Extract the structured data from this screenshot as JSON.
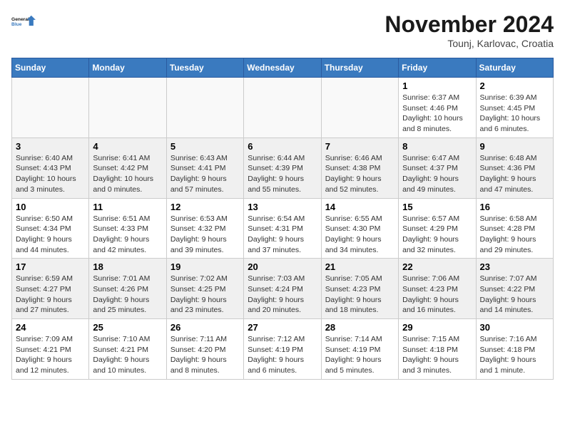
{
  "logo": {
    "text_general": "General",
    "text_blue": "Blue"
  },
  "title": "November 2024",
  "subtitle": "Tounj, Karlovac, Croatia",
  "days_of_week": [
    "Sunday",
    "Monday",
    "Tuesday",
    "Wednesday",
    "Thursday",
    "Friday",
    "Saturday"
  ],
  "weeks": [
    [
      {
        "day": "",
        "info": ""
      },
      {
        "day": "",
        "info": ""
      },
      {
        "day": "",
        "info": ""
      },
      {
        "day": "",
        "info": ""
      },
      {
        "day": "",
        "info": ""
      },
      {
        "day": "1",
        "info": "Sunrise: 6:37 AM\nSunset: 4:46 PM\nDaylight: 10 hours and 8 minutes."
      },
      {
        "day": "2",
        "info": "Sunrise: 6:39 AM\nSunset: 4:45 PM\nDaylight: 10 hours and 6 minutes."
      }
    ],
    [
      {
        "day": "3",
        "info": "Sunrise: 6:40 AM\nSunset: 4:43 PM\nDaylight: 10 hours and 3 minutes."
      },
      {
        "day": "4",
        "info": "Sunrise: 6:41 AM\nSunset: 4:42 PM\nDaylight: 10 hours and 0 minutes."
      },
      {
        "day": "5",
        "info": "Sunrise: 6:43 AM\nSunset: 4:41 PM\nDaylight: 9 hours and 57 minutes."
      },
      {
        "day": "6",
        "info": "Sunrise: 6:44 AM\nSunset: 4:39 PM\nDaylight: 9 hours and 55 minutes."
      },
      {
        "day": "7",
        "info": "Sunrise: 6:46 AM\nSunset: 4:38 PM\nDaylight: 9 hours and 52 minutes."
      },
      {
        "day": "8",
        "info": "Sunrise: 6:47 AM\nSunset: 4:37 PM\nDaylight: 9 hours and 49 minutes."
      },
      {
        "day": "9",
        "info": "Sunrise: 6:48 AM\nSunset: 4:36 PM\nDaylight: 9 hours and 47 minutes."
      }
    ],
    [
      {
        "day": "10",
        "info": "Sunrise: 6:50 AM\nSunset: 4:34 PM\nDaylight: 9 hours and 44 minutes."
      },
      {
        "day": "11",
        "info": "Sunrise: 6:51 AM\nSunset: 4:33 PM\nDaylight: 9 hours and 42 minutes."
      },
      {
        "day": "12",
        "info": "Sunrise: 6:53 AM\nSunset: 4:32 PM\nDaylight: 9 hours and 39 minutes."
      },
      {
        "day": "13",
        "info": "Sunrise: 6:54 AM\nSunset: 4:31 PM\nDaylight: 9 hours and 37 minutes."
      },
      {
        "day": "14",
        "info": "Sunrise: 6:55 AM\nSunset: 4:30 PM\nDaylight: 9 hours and 34 minutes."
      },
      {
        "day": "15",
        "info": "Sunrise: 6:57 AM\nSunset: 4:29 PM\nDaylight: 9 hours and 32 minutes."
      },
      {
        "day": "16",
        "info": "Sunrise: 6:58 AM\nSunset: 4:28 PM\nDaylight: 9 hours and 29 minutes."
      }
    ],
    [
      {
        "day": "17",
        "info": "Sunrise: 6:59 AM\nSunset: 4:27 PM\nDaylight: 9 hours and 27 minutes."
      },
      {
        "day": "18",
        "info": "Sunrise: 7:01 AM\nSunset: 4:26 PM\nDaylight: 9 hours and 25 minutes."
      },
      {
        "day": "19",
        "info": "Sunrise: 7:02 AM\nSunset: 4:25 PM\nDaylight: 9 hours and 23 minutes."
      },
      {
        "day": "20",
        "info": "Sunrise: 7:03 AM\nSunset: 4:24 PM\nDaylight: 9 hours and 20 minutes."
      },
      {
        "day": "21",
        "info": "Sunrise: 7:05 AM\nSunset: 4:23 PM\nDaylight: 9 hours and 18 minutes."
      },
      {
        "day": "22",
        "info": "Sunrise: 7:06 AM\nSunset: 4:23 PM\nDaylight: 9 hours and 16 minutes."
      },
      {
        "day": "23",
        "info": "Sunrise: 7:07 AM\nSunset: 4:22 PM\nDaylight: 9 hours and 14 minutes."
      }
    ],
    [
      {
        "day": "24",
        "info": "Sunrise: 7:09 AM\nSunset: 4:21 PM\nDaylight: 9 hours and 12 minutes."
      },
      {
        "day": "25",
        "info": "Sunrise: 7:10 AM\nSunset: 4:21 PM\nDaylight: 9 hours and 10 minutes."
      },
      {
        "day": "26",
        "info": "Sunrise: 7:11 AM\nSunset: 4:20 PM\nDaylight: 9 hours and 8 minutes."
      },
      {
        "day": "27",
        "info": "Sunrise: 7:12 AM\nSunset: 4:19 PM\nDaylight: 9 hours and 6 minutes."
      },
      {
        "day": "28",
        "info": "Sunrise: 7:14 AM\nSunset: 4:19 PM\nDaylight: 9 hours and 5 minutes."
      },
      {
        "day": "29",
        "info": "Sunrise: 7:15 AM\nSunset: 4:18 PM\nDaylight: 9 hours and 3 minutes."
      },
      {
        "day": "30",
        "info": "Sunrise: 7:16 AM\nSunset: 4:18 PM\nDaylight: 9 hours and 1 minute."
      }
    ]
  ]
}
